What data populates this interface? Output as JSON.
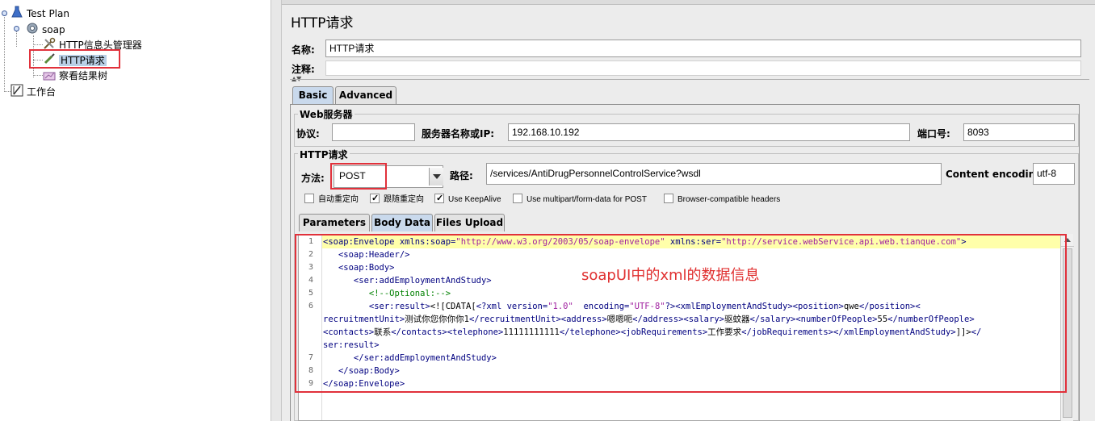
{
  "tree": {
    "test_plan": "Test Plan",
    "soap": "soap",
    "header_manager": "HTTP信息头管理器",
    "http_request": "HTTP请求",
    "result_tree": "察看结果树",
    "workbench": "工作台"
  },
  "panel": {
    "title": "HTTP请求",
    "name_label": "名称:",
    "name_value": "HTTP请求",
    "comment_label": "注释:",
    "tabs": [
      "Basic",
      "Advanced"
    ]
  },
  "web_server": {
    "group_title": "Web服务器",
    "protocol_label": "协议:",
    "protocol_value": "",
    "server_label": "服务器名称或IP:",
    "server_value": "192.168.10.192",
    "port_label": "端口号:",
    "port_value": "8093"
  },
  "http_request": {
    "group_title": "HTTP请求",
    "method_label": "方法:",
    "method_value": "POST",
    "path_label": "路径:",
    "path_value": "/services/AntiDrugPersonnelControlService?wsdl",
    "encoding_label": "Content encoding:",
    "encoding_value": "utf-8"
  },
  "options": [
    {
      "label": "自动重定向",
      "checked": false
    },
    {
      "label": "跟随重定向",
      "checked": true
    },
    {
      "label": "Use KeepAlive",
      "checked": true
    },
    {
      "label": "Use multipart/form-data for POST",
      "checked": false
    },
    {
      "label": "Browser-compatible headers",
      "checked": false
    }
  ],
  "subtabs": [
    "Parameters",
    "Body Data",
    "Files Upload"
  ],
  "editor": {
    "line_numbers": [
      "1",
      "2",
      "3",
      "4",
      "5",
      "6",
      "",
      "",
      "",
      "7",
      "8",
      "9"
    ]
  },
  "annotation": "soapUI中的xml的数据信息",
  "colors": {
    "highlight_box": "#e1313b",
    "selected_tab": "#c9d9ec",
    "current_line": "#ffffaa"
  }
}
